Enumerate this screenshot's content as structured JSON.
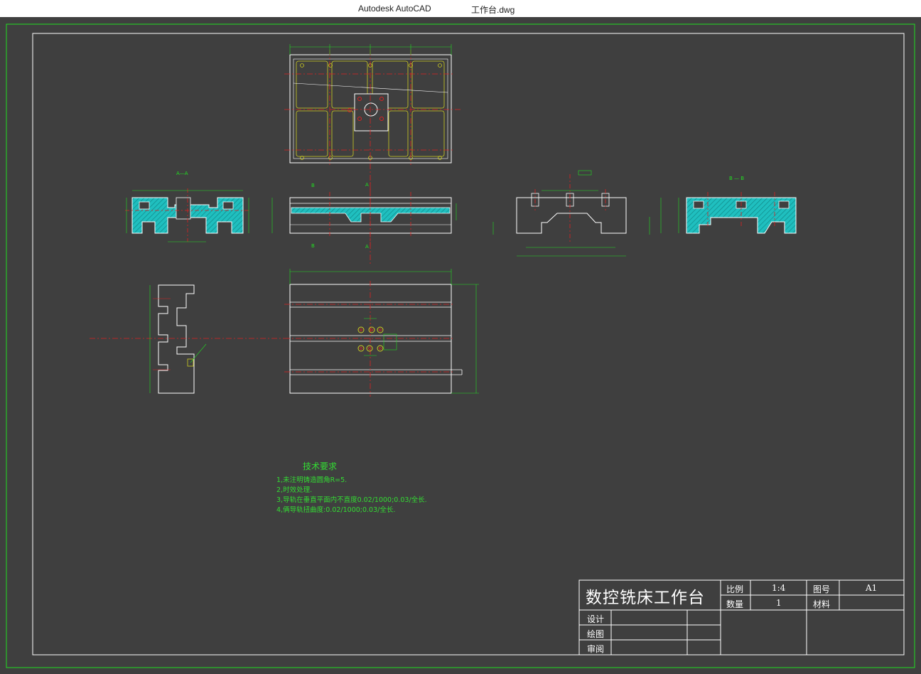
{
  "window": {
    "app_title": "Autodesk AutoCAD",
    "file_name": "工作台.dwg"
  },
  "drawing": {
    "section_labels": {
      "aa": "A—A",
      "bb": "B — B",
      "a_top": "A",
      "a_bottom": "A",
      "b_top": "B",
      "b_bottom": "B"
    },
    "tech_requirements": {
      "heading": "技术要求",
      "items": [
        "1,未注明铸造圆角R=5.",
        "2,时效处理.",
        "3,导轨在垂直平面内不直度0.02/1000;0.03/全长.",
        "4,俩导轨扭曲度:0.02/1000;0.03/全长."
      ]
    }
  },
  "title_block": {
    "title": "数控铣床工作台",
    "scale_label": "比例",
    "scale_value": "1:4",
    "drawing_no_label": "图号",
    "drawing_no_value": "A1",
    "quantity_label": "数量",
    "quantity_value": "1",
    "material_label": "材料",
    "material_value": "",
    "design_label": "设计",
    "drawn_label": "绘图",
    "review_label": "审阅"
  },
  "colors": {
    "background": "#3f3f3f",
    "border": "#22dd22",
    "geometry": "#ffffff",
    "centerline": "#dd2222",
    "hatch": "#22cccc",
    "dimension": "#22dd22",
    "rib": "#cccc22"
  }
}
